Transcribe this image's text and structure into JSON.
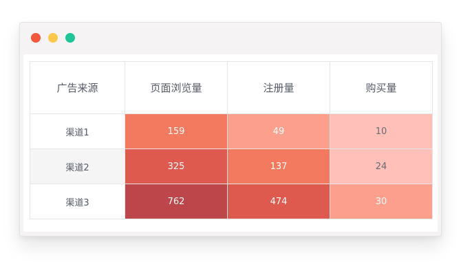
{
  "window": {
    "controls": {
      "close_color": "#f5573a",
      "minimize_color": "#fbc849",
      "maximize_color": "#1ec597"
    }
  },
  "table": {
    "headers": [
      "广告来源",
      "页面浏览量",
      "注册量",
      "购买量"
    ],
    "rows": [
      {
        "label": "渠道1",
        "values": [
          "159",
          "49",
          "10"
        ],
        "colors": [
          "#f47a5f",
          "#fca08d",
          "#fec0b9"
        ]
      },
      {
        "label": "渠道2",
        "values": [
          "325",
          "137",
          "24"
        ],
        "colors": [
          "#de5a4f",
          "#f47a5f",
          "#fec0b9"
        ]
      },
      {
        "label": "渠道3",
        "values": [
          "762",
          "474",
          "30"
        ],
        "colors": [
          "#bc4649",
          "#de5a4f",
          "#fca08d"
        ]
      }
    ]
  }
}
